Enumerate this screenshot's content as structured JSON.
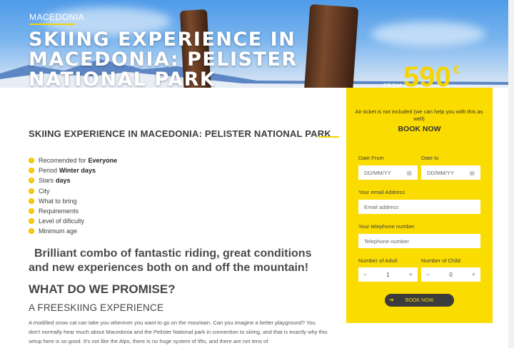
{
  "hero": {
    "country": "MACEDONIA",
    "title": "SKIING EXPERIENCE IN MACEDONIA: PELISTER NATIONAL PARK",
    "from_label": "FROM",
    "price": "590",
    "currency": "€"
  },
  "main": {
    "title": "SKIING EXPERIENCE IN MACEDONIA: PELISTER NATIONAL PARK",
    "facts": [
      {
        "label": "Recomended for",
        "value": "Everyone"
      },
      {
        "label": "Period",
        "value": "Winter days"
      },
      {
        "label": "Stars",
        "value": "days"
      },
      {
        "label": "City",
        "value": ""
      },
      {
        "label": "What to bring",
        "value": ""
      },
      {
        "label": "Requirements",
        "value": ""
      },
      {
        "label": "Level of dificulty",
        "value": ""
      },
      {
        "label": "Minimum age",
        "value": ""
      }
    ],
    "lead": "Brilliant combo of fantastic riding, great conditions and new experiences both on and off the mountain!",
    "h2": "WHAT DO WE PROMISE?",
    "h3": "A FREESKIING EXPERIENCE",
    "paragraph": "A modified snow cat can take you wherever you want to go on the mountain. Can you imagine a better playground? You don't normally hear much about Macedonia and the Pelister National park in connection to skiing, and that is exactly why this setup here is so good. It's not like the Alps, there is no huge system of lifts, and there are not tens of"
  },
  "booking": {
    "note": "Air ticket is not included (we can help you with this as well)",
    "heading": "BOOK NOW",
    "date_from_label": "Date From",
    "date_from_placeholder": "DD/MM/YY",
    "date_to_label": "Date to",
    "date_to_placeholder": "DD/MM/YY",
    "email_label": "Your email Address",
    "email_placeholder": "Email address",
    "phone_label": "Your telephone number",
    "phone_placeholder": "Telephone number",
    "adult_label": "Number of Adult",
    "adult_value": "1",
    "child_label": "Number of Child",
    "child_value": "0",
    "minus": "−",
    "plus": "+",
    "button_label": "BOOK NOW"
  },
  "icons": {
    "calendar": "calendar-icon",
    "bullet": "chevron-circle-icon",
    "arrow": "arrow-right-icon"
  },
  "colors": {
    "accent": "#fbdc00",
    "button": "#3c3c3c"
  }
}
